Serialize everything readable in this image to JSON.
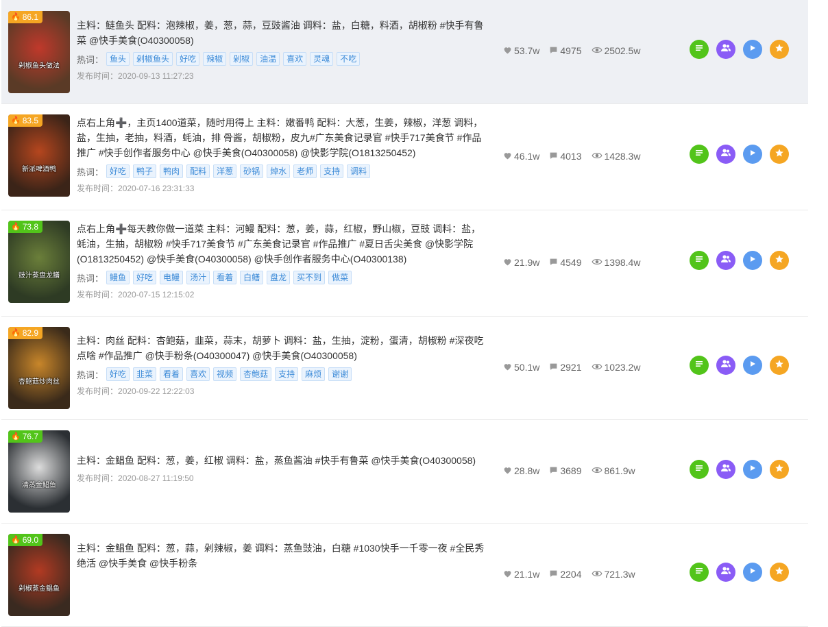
{
  "labels": {
    "hot": "热词：",
    "date_prefix": "发布时间："
  },
  "colors": {
    "score_orange": "#f5a623",
    "score_green": "#52c41a",
    "tag_blue": "#3d8bd8"
  },
  "icons": [
    "fire-icon",
    "heart-icon",
    "comment-icon",
    "eye-icon",
    "list-icon",
    "users-icon",
    "play-icon",
    "star-icon"
  ],
  "items": [
    {
      "score": "86.1",
      "score_color": "orange",
      "caption": "剁椒鱼头做法",
      "desc": "主料：鲢鱼头 配料：泡辣椒，姜，葱，蒜，豆豉酱油 调料：盐，白糖，料酒，胡椒粉 #快手有鲁菜 @快手美食(O40300058)",
      "tags": [
        "鱼头",
        "剁椒鱼头",
        "好吃",
        "辣椒",
        "剁椒",
        "油温",
        "喜欢",
        "灵魂",
        "不吃"
      ],
      "date": "2020-09-13 11:27:23",
      "likes": "53.7w",
      "comments": "4975",
      "views": "2502.5w"
    },
    {
      "score": "83.5",
      "score_color": "orange",
      "caption": "新派啤酒鸭",
      "desc": "点右上角➕，主页1400道菜，随时用得上 主料：嫩番鸭 配料：大葱，生姜，辣椒，洋葱 调料，盐，生抽，老抽，料酒，蚝油，排 骨酱，胡椒粉，皮九#广东美食记录官 #快手717美食节 #作品推广 #快手创作者服务中心 @快手美食(O40300058) @快影学院(O1813250452)",
      "tags": [
        "好吃",
        "鸭子",
        "鸭肉",
        "配料",
        "洋葱",
        "砂锅",
        "焯水",
        "老师",
        "支持",
        "调料"
      ],
      "date": "2020-07-16 23:31:33",
      "likes": "46.1w",
      "comments": "4013",
      "views": "1428.3w"
    },
    {
      "score": "73.8",
      "score_color": "green",
      "caption": "豉汁蒸盘龙鳝",
      "desc": "点右上角➕每天教你做一道菜 主料：河鳗 配料：葱，姜，蒜，红椒，野山椒，豆豉 调料：盐，蚝油，生抽，胡椒粉 #快手717美食节 #广东美食记录官 #作品推广 #夏日舌尖美食 @快影学院(O1813250452) @快手美食(O40300058) @快手创作者服务中心(O40300138)",
      "tags": [
        "鳗鱼",
        "好吃",
        "电鳗",
        "汤汁",
        "看着",
        "白鳝",
        "盘龙",
        "买不到",
        "做菜"
      ],
      "date": "2020-07-15 12:15:02",
      "likes": "21.9w",
      "comments": "4549",
      "views": "1398.4w"
    },
    {
      "score": "82.9",
      "score_color": "orange",
      "caption": "杏鲍菇炒肉丝",
      "desc": "主料：肉丝 配料：杏鲍菇，韭菜，蒜末，胡萝卜 调料：盐，生抽，淀粉，蛋清，胡椒粉 #深夜吃点啥 #作品推广 @快手粉条(O40300047) @快手美食(O40300058)",
      "tags": [
        "好吃",
        "韭菜",
        "看着",
        "喜欢",
        "视频",
        "杏鲍菇",
        "支持",
        "麻烦",
        "谢谢"
      ],
      "date": "2020-09-22 12:22:03",
      "likes": "50.1w",
      "comments": "2921",
      "views": "1023.2w"
    },
    {
      "score": "76.7",
      "score_color": "green",
      "caption": "清蒸金鲳鱼",
      "desc": "主料：金鲳鱼 配料：葱，姜，红椒 调料：盐，蒸鱼酱油 #快手有鲁菜 @快手美食(O40300058)",
      "tags": [],
      "date": "2020-08-27 11:19:50",
      "likes": "28.8w",
      "comments": "3689",
      "views": "861.9w"
    },
    {
      "score": "69.0",
      "score_color": "green",
      "caption": "剁椒蒸金鲳鱼",
      "desc": "主料：金鲳鱼 配料：葱，蒜，剁辣椒，姜 调料：蒸鱼豉油，白糖 #1030快手一千零一夜 #全民秀绝活 @快手美食 @快手粉条",
      "tags": [],
      "date": "",
      "likes": "21.1w",
      "comments": "2204",
      "views": "721.3w"
    }
  ]
}
